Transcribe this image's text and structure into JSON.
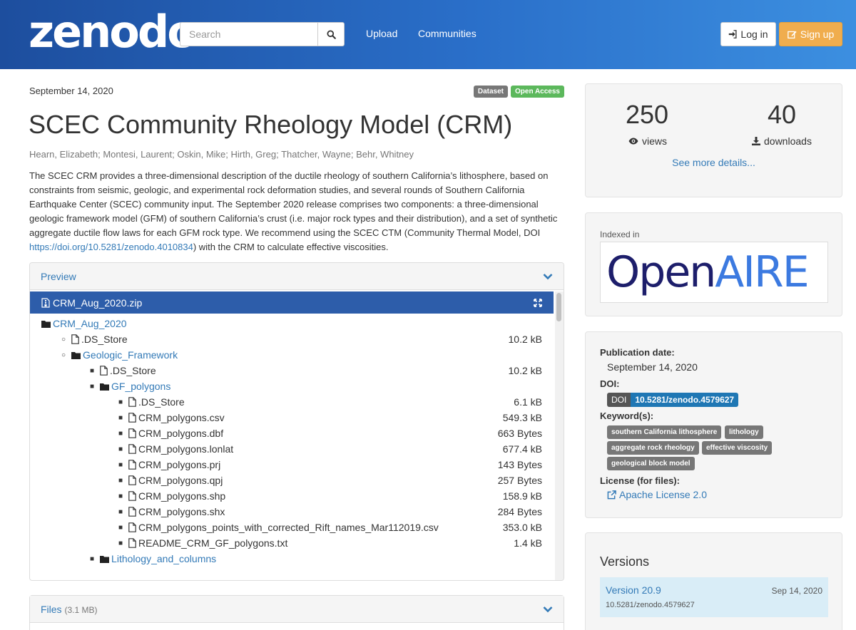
{
  "header": {
    "logo": "zenodo",
    "search_placeholder": "Search",
    "nav": [
      {
        "label": "Upload"
      },
      {
        "label": "Communities"
      }
    ],
    "login_label": "Log in",
    "signup_label": "Sign up"
  },
  "record": {
    "date": "September 14, 2020",
    "badges": {
      "type": "Dataset",
      "access": "Open Access"
    },
    "title": "SCEC Community Rheology Model (CRM)",
    "authors": "Hearn, Elizabeth; Montesi, Laurent; Oskin, Mike; Hirth, Greg; Thatcher, Wayne; Behr, Whitney",
    "description_before": "The SCEC CRM provides a three-dimensional description of the ductile rheology of southern California’s lithosphere, based on constraints from seismic, geologic, and experimental rock deformation studies, and several rounds of Southern California Earthquake Center (SCEC) community input. The September 2020 release comprises two components: a three-dimensional geologic framework model (GFM) of southern California’s crust (i.e. major rock types and their distribution), and a set of synthetic aggregate ductile flow laws for each GFM rock type. We recommend using the SCEC CTM (Community Thermal Model, DOI ",
    "description_link": "https://doi.org/10.5281/zenodo.4010834",
    "description_after": ") with the CRM to calculate effective viscosities."
  },
  "preview": {
    "heading": "Preview",
    "file_name": "CRM_Aug_2020.zip",
    "tree": [
      {
        "name": "CRM_Aug_2020",
        "kind": "folder",
        "level": 0,
        "size": ""
      },
      {
        "name": ".DS_Store",
        "kind": "file",
        "level": 1,
        "size": "10.2 kB"
      },
      {
        "name": "Geologic_Framework",
        "kind": "folder",
        "level": 1,
        "size": ""
      },
      {
        "name": ".DS_Store",
        "kind": "file",
        "level": 2,
        "size": "10.2 kB"
      },
      {
        "name": "GF_polygons",
        "kind": "folder",
        "level": 2,
        "size": ""
      },
      {
        "name": ".DS_Store",
        "kind": "file",
        "level": 3,
        "size": "6.1 kB"
      },
      {
        "name": "CRM_polygons.csv",
        "kind": "file",
        "level": 3,
        "size": "549.3 kB"
      },
      {
        "name": "CRM_polygons.dbf",
        "kind": "file",
        "level": 3,
        "size": "663 Bytes"
      },
      {
        "name": "CRM_polygons.lonlat",
        "kind": "file",
        "level": 3,
        "size": "677.4 kB"
      },
      {
        "name": "CRM_polygons.prj",
        "kind": "file",
        "level": 3,
        "size": "143 Bytes"
      },
      {
        "name": "CRM_polygons.qpj",
        "kind": "file",
        "level": 3,
        "size": "257 Bytes"
      },
      {
        "name": "CRM_polygons.shp",
        "kind": "file",
        "level": 3,
        "size": "158.9 kB"
      },
      {
        "name": "CRM_polygons.shx",
        "kind": "file",
        "level": 3,
        "size": "284 Bytes"
      },
      {
        "name": "CRM_polygons_points_with_corrected_Rift_names_Mar112019.csv",
        "kind": "file",
        "level": 3,
        "size": "353.0 kB"
      },
      {
        "name": "README_CRM_GF_polygons.txt",
        "kind": "file",
        "level": 3,
        "size": "1.4 kB"
      },
      {
        "name": "Lithology_and_columns",
        "kind": "folder",
        "level": 2,
        "size": ""
      }
    ]
  },
  "files": {
    "heading": "Files",
    "size": "(3.1 MB)"
  },
  "stats": {
    "views": "250",
    "views_label": "views",
    "downloads": "40",
    "downloads_label": "downloads",
    "see_more": "See more details..."
  },
  "indexed": {
    "label": "Indexed in",
    "logo_open": "Open",
    "logo_aire": "AIRE"
  },
  "meta": {
    "pub_date_label": "Publication date:",
    "pub_date": "September 14, 2020",
    "doi_label": "DOI:",
    "doi_prefix": "DOI",
    "doi": "10.5281/zenodo.4579627",
    "keywords_label": "Keyword(s):",
    "keywords": [
      "southern California lithosphere",
      "lithology",
      "aggregate rock rheology",
      "effective viscosity",
      "geological block model"
    ],
    "license_label": "License (for files):",
    "license": "Apache License 2.0"
  },
  "versions": {
    "title": "Versions",
    "items": [
      {
        "name": "Version 20.9",
        "date": "Sep 14, 2020",
        "doi": "10.5281/zenodo.4579627"
      }
    ]
  },
  "colors": {
    "nav_start": "#1d4e9e",
    "nav_end": "#3c8fe0",
    "link": "#337ab7",
    "signup": "#f0ad4e",
    "open_access": "#5cb85c",
    "file_bar": "#2d5daa"
  }
}
